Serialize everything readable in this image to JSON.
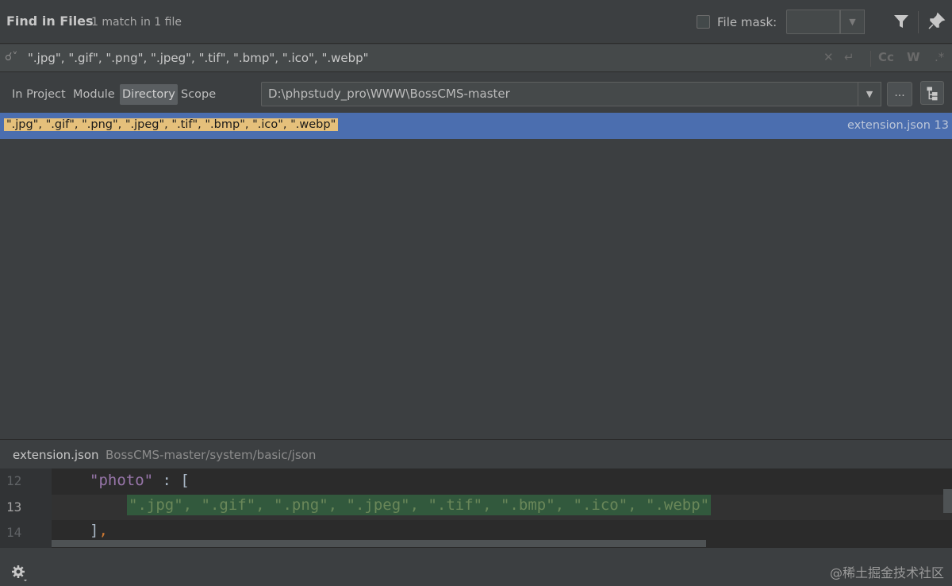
{
  "header": {
    "title": "Find in Files",
    "match_count": "1 match in 1 file",
    "file_mask_label": "File mask:"
  },
  "search": {
    "query": "\".jpg\", \".gif\", \".png\", \".jpeg\", \".tif\", \".bmp\", \".ico\", \".webp\"",
    "match_case_label": "Cc",
    "words_label": "W"
  },
  "scope": {
    "tabs": [
      {
        "label": "In Project",
        "active": false
      },
      {
        "label": "Module",
        "active": false
      },
      {
        "label": "Directory",
        "active": true
      },
      {
        "label": "Scope",
        "active": false
      }
    ],
    "directory": "D:\\phpstudy_pro\\WWW\\BossCMS-master",
    "browse_label": "..."
  },
  "results": [
    {
      "text": "\".jpg\", \".gif\", \".png\", \".jpeg\", \".tif\", \".bmp\", \".ico\", \".webp\"",
      "file": "extension.json 13"
    }
  ],
  "preview": {
    "filename": "extension.json",
    "path": "BossCMS-master/system/basic/json",
    "lines": [
      {
        "num": "12",
        "key": "\"photo\"",
        "sep": " : ",
        "open": "["
      },
      {
        "num": "13",
        "code": "\".jpg\", \".gif\", \".png\", \".jpeg\", \".tif\", \".bmp\", \".ico\", \".webp\""
      },
      {
        "num": "14",
        "close": "]",
        "comma": ","
      }
    ]
  },
  "footer": {
    "watermark": "@稀土掘金技术社区"
  },
  "colors": {
    "accent_selection": "#4b6eaf",
    "match_highlight": "#e5c07b",
    "code_string": "#6a8759",
    "code_key": "#9876aa"
  }
}
